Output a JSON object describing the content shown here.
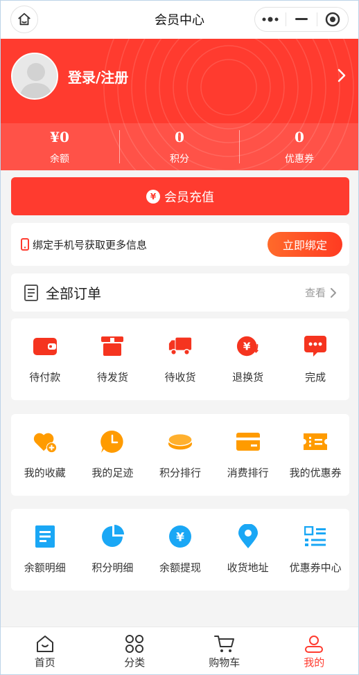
{
  "topbar": {
    "title": "会员中心"
  },
  "header": {
    "login_text": "登录/注册",
    "stats": [
      {
        "value": "¥0",
        "label": "余额"
      },
      {
        "value": "0",
        "label": "积分"
      },
      {
        "value": "0",
        "label": "优惠券"
      }
    ]
  },
  "recharge": {
    "icon_text": "¥",
    "label": "会员充值"
  },
  "bind": {
    "text": "绑定手机号获取更多信息",
    "button": "立即绑定"
  },
  "orders": {
    "title": "全部订单",
    "more": "查看"
  },
  "order_items": [
    {
      "label": "待付款",
      "icon": "wallet-icon"
    },
    {
      "label": "待发货",
      "icon": "package-icon"
    },
    {
      "label": "待收货",
      "icon": "truck-icon"
    },
    {
      "label": "退换货",
      "icon": "refund-icon"
    },
    {
      "label": "完成",
      "icon": "chat-dots-icon"
    }
  ],
  "service_items": [
    {
      "label": "我的收藏",
      "icon": "heart-plus-icon"
    },
    {
      "label": "我的足迹",
      "icon": "clock-bubble-icon"
    },
    {
      "label": "积分排行",
      "icon": "coins-icon"
    },
    {
      "label": "消费排行",
      "icon": "card-icon"
    },
    {
      "label": "我的优惠券",
      "icon": "ticket-icon"
    }
  ],
  "account_items": [
    {
      "label": "余额明细",
      "icon": "document-icon"
    },
    {
      "label": "积分明细",
      "icon": "pie-chart-icon"
    },
    {
      "label": "余额提现",
      "icon": "yen-circle-icon"
    },
    {
      "label": "收货地址",
      "icon": "location-pin-icon"
    },
    {
      "label": "优惠券中心",
      "icon": "list-icon"
    }
  ],
  "tabbar": [
    {
      "label": "首页",
      "icon": "home-icon"
    },
    {
      "label": "分类",
      "icon": "category-icon"
    },
    {
      "label": "购物车",
      "icon": "cart-icon"
    },
    {
      "label": "我的",
      "icon": "user-icon",
      "active": true
    }
  ],
  "colors": {
    "primary": "#ff3b2f",
    "orange": "#ff9b00",
    "blue": "#1aa7f5"
  }
}
